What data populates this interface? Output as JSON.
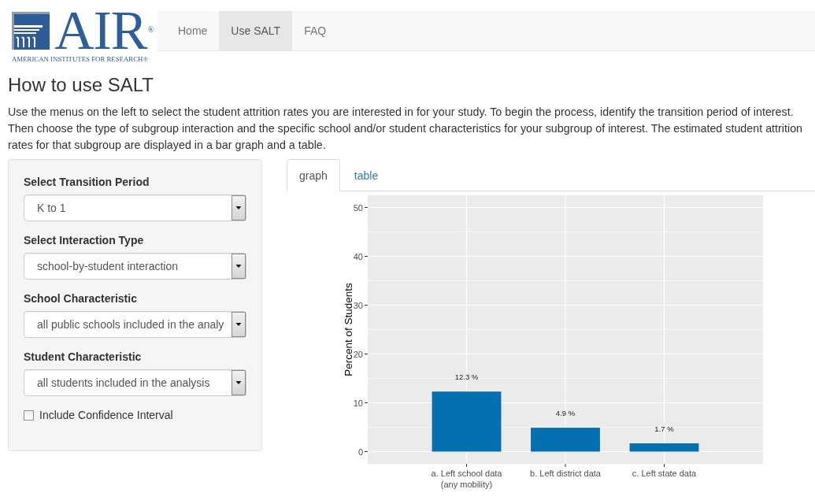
{
  "logo": {
    "wordmark": "AIR$^{®}$",
    "tagline": "AMERICAN INSTITUTES FOR RESEARCH®"
  },
  "nav": [
    {
      "label": "Home",
      "selected": false
    },
    {
      "label": "Use SALT",
      "selected": true
    },
    {
      "label": "FAQ",
      "selected": false
    }
  ],
  "heading": "How to use SALT",
  "intro": "Use the menus on the left to select the student attrition rates you are interested in for your study. To begin the process, identify the transition period of interest. Then choose the type of subgroup interaction and the specific school and/or student characteristics for your subgroup of interest. The estimated student attrition rates for that subgroup are displayed in a bar graph and a table.",
  "sidebar": {
    "selects": [
      {
        "label": "Select Transition Period",
        "value": "K to 1"
      },
      {
        "label": "Select Interaction Type",
        "value": "school-by-student interaction"
      },
      {
        "label": "School Characteristic",
        "value": "all public schools included in the analy"
      },
      {
        "label": "Student Characteristic",
        "value": "all students included in the analysis"
      }
    ],
    "checkbox": {
      "label": "Include Confidence Interval",
      "checked": false
    }
  },
  "tabs": [
    {
      "label": "graph",
      "selected": true
    },
    {
      "label": "table",
      "selected": false
    }
  ],
  "graph": {
    "chart_data": {
      "type": "bar",
      "ylabel": "Percent of Students",
      "categories": [
        "a. Left school data\n(any mobility)",
        "b. Left district data",
        "c. Left state data"
      ],
      "series": [
        {
          "color": "#0570b0",
          "values": [
            12.3,
            4.9,
            1.7
          ]
        }
      ],
      "value_labels": [
        "12.3 %",
        "4.9 %",
        "1.7 %"
      ],
      "ylim": [
        -2.5,
        52.5
      ],
      "yticks": [
        0,
        10,
        20,
        30,
        40,
        50
      ],
      "grid": true
    }
  }
}
